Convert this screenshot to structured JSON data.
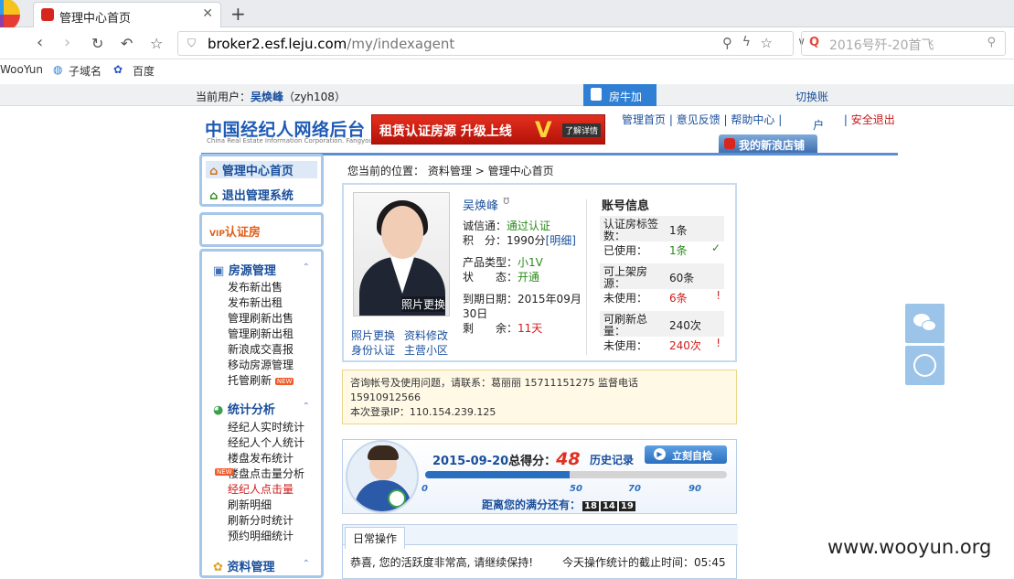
{
  "browser": {
    "tab_title": "管理中心首页",
    "url_domain": "broker2.esf.leju.com",
    "url_path": "/my/indexagent",
    "search_placeholder": "2016号歼-20首飞",
    "bookmarks": [
      "WooYun",
      "子域名",
      "百度"
    ]
  },
  "topbar": {
    "current_user_label": "当前用户：",
    "user_name": "吴焕峰",
    "user_id": "（zyh108）",
    "fangniu": "房牛加",
    "switch_account": "切换账",
    "switch_account_2": "户"
  },
  "header": {
    "logo": "中国经纪人网络后台",
    "logo_sub": "China Real Estate Information Corporation. Fangyou.com",
    "banner_text": "租赁认证房源 升级上线",
    "banner_v": "V",
    "banner_button": "了解详情",
    "links": [
      "管理首页",
      "意见反馈",
      "帮助中心"
    ],
    "logout": "安全退出",
    "shop_button": "我的新浪店铺"
  },
  "sidebar": {
    "home": "管理中心首页",
    "exit": "退出管理系统",
    "verified": "认证房",
    "verified_prefix": "VIP",
    "housing": {
      "title": "房源管理",
      "items": [
        "发布新出售",
        "发布新出租",
        "管理刷新出售",
        "管理刷新出租",
        "新浪成交喜报",
        "移动房源管理",
        "托管刷新"
      ]
    },
    "stats": {
      "title": "统计分析",
      "items": [
        "经纪人实时统计",
        "经纪人个人统计",
        "楼盘发布统计",
        "楼盘点击量分析",
        "经纪人点击量",
        "刷新明细",
        "刷新分时统计",
        "预约明细统计"
      ]
    },
    "data": {
      "title": "资料管理"
    },
    "badge_new": "NEW"
  },
  "main": {
    "breadcrumb_prefix": "您当前的位置：",
    "breadcrumb_1": "资料管理",
    "breadcrumb_sep": ">",
    "breadcrumb_2": "管理中心首页",
    "photo_change": "照片更换",
    "name": "吴焕峰",
    "cert_label": "诚信通：",
    "cert_value": "通过认证",
    "points_label": "积　分：",
    "points_value": "1990分",
    "points_detail": "[明细]",
    "product_label": "产品类型：",
    "product_value": "小1V",
    "status_label": "状　　态：",
    "status_value": "开通",
    "expire_label": "到期日期：",
    "expire_value": "2015年09月",
    "expire_value_2": "30日",
    "remain_label": "剩　　余：",
    "remain_value": "11天",
    "links": [
      "照片更换",
      "资料修改",
      "身份认证",
      "主营小区"
    ],
    "account": {
      "title": "账号信息",
      "rows": [
        {
          "k1": "认证房标签",
          "k2": "数：",
          "v": "1条",
          "k3": "已使用：",
          "v2": "1条",
          "mark": "✓"
        },
        {
          "k1": "可上架房",
          "k2": "源：",
          "v": "60条",
          "k3": "未使用：",
          "v2": "6条",
          "mark": "!"
        },
        {
          "k1": "可刷新总",
          "k2": "量：",
          "v": "240次",
          "k3": "未使用：",
          "v2": "240次",
          "mark": "!"
        }
      ]
    },
    "contact": {
      "line1": "咨询帐号及使用问题，请联系：葛丽丽  15711151275       监督电话",
      "line2": "15910912566",
      "line3": "本次登录IP：110.154.239.125"
    },
    "score": {
      "date": "2015-09-20",
      "score_label": "总得分：",
      "score_value": "48",
      "history": "历史记录",
      "self_check": "立刻自检",
      "progress_fraction": 0.48,
      "ticks": [
        "0",
        "50",
        "70",
        "90"
      ],
      "remain_label": "距离您的满分还有：",
      "remain_digits": [
        "18",
        "14",
        "19"
      ]
    },
    "daily": {
      "tab": "日常操作",
      "message": "恭喜, 您的活跃度非常高, 请继续保持!",
      "time_label": "今天操作统计的截止时间：",
      "time_value": "05:45"
    }
  },
  "watermark": "www.wooyun.org",
  "colors": {
    "brand_blue": "#1a4f9c",
    "accent_red": "#d01c1c",
    "banner_red": "#e42f1f"
  }
}
